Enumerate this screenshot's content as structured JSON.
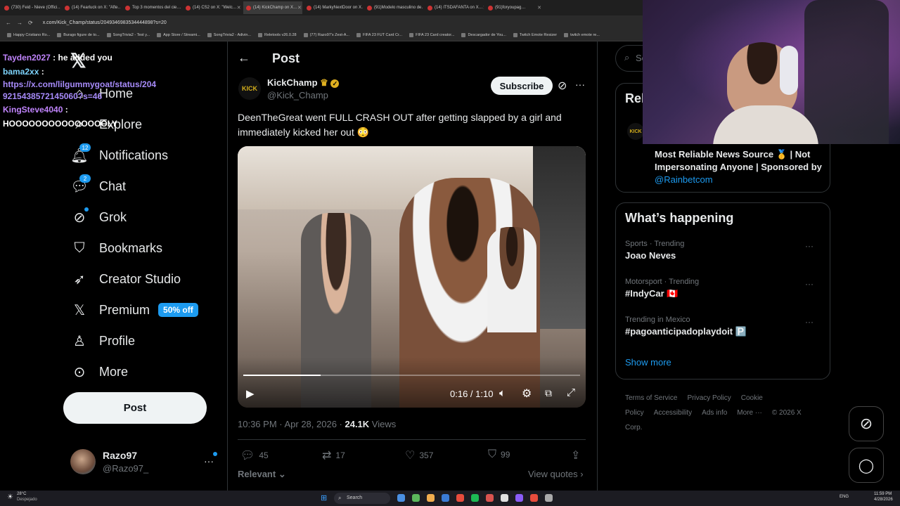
{
  "browser": {
    "tabs": [
      "(730) Feid - Nieve (Offici…",
      "(14) Fearluck on X: \"Afte…",
      "Top 3 momentos del cie…",
      "(14) CS2 on X: \"Welc…",
      "(14) KickChamp on X…",
      "(14) MarkyNextDoor on X…",
      "(91)Modelo masculino de…",
      "(14) ITSDAFANTA on X…",
      "(91)foryoupag…"
    ],
    "url": "x.com/Kick_Champ/status/2049346983534444898?s=20",
    "bookmarks": [
      "Happy Cristiano Ro...",
      "Burago figure de to...",
      "SongTrivia2 - Test y...",
      "App Store / Streami...",
      "SongTrivia2 - Adivin...",
      "Reletools v26.0.28",
      "(77) Razo97's Zest-A...",
      "FIFA 23 FUT Card Cr...",
      "FIFA 23 Card creator...",
      "Descargador de You...",
      "Twitch Emote Resizer",
      "twitch emote re..."
    ]
  },
  "chat_overlay": {
    "lines": [
      {
        "user": "Tayden2027",
        "text": " : he added you"
      },
      {
        "user": "bama2xx",
        "text": " :"
      },
      {
        "user": "",
        "text": "https://x.com/lilgummygoat/status/2049215438572145060?s=46"
      },
      {
        "user": "KingSteve4040",
        "text": " :"
      },
      {
        "user": "",
        "text": "HOOOOOOOOOOOOOOOLY"
      }
    ]
  },
  "sidebar": {
    "items": [
      {
        "label": "Home",
        "icon": "home-icon"
      },
      {
        "label": "Explore",
        "icon": "search-icon"
      },
      {
        "label": "Notifications",
        "icon": "bell-icon",
        "badge": "12"
      },
      {
        "label": "Chat",
        "icon": "chat-icon",
        "badge": "2"
      },
      {
        "label": "Grok",
        "icon": "grok-icon"
      },
      {
        "label": "Bookmarks",
        "icon": "bookmark-icon"
      },
      {
        "label": "Creator Studio",
        "icon": "rocket-icon"
      },
      {
        "label": "Premium",
        "icon": "x-logo-icon",
        "promo": "50% off"
      },
      {
        "label": "Profile",
        "icon": "person-icon"
      },
      {
        "label": "More",
        "icon": "more-circle-icon"
      }
    ],
    "post_button": "Post",
    "account": {
      "name": "Razo97",
      "handle": "@Razo97_"
    }
  },
  "post": {
    "header_title": "Post",
    "author_name": "KickChamp",
    "author_handle": "@Kick_Champ",
    "avatar_text": "KICK",
    "subscribe_label": "Subscribe",
    "text": "DeenTheGreat went FULL CRASH OUT after getting slapped by a girl and immediately kicked her out 😳",
    "video": {
      "time": "0:16 / 1:10",
      "progress": 0.23
    },
    "timestamp": "10:36 PM · Apr 28, 2026 · ",
    "views_count": "24.1K",
    "views_label": " Views",
    "replies": "45",
    "reposts": "17",
    "likes": "357",
    "bookmarks": "99",
    "relevant_label": "Relevant",
    "view_quotes_label": "View quotes"
  },
  "right": {
    "search_placeholder": "Se",
    "relevant_title": "Rele",
    "relevant_bio": "Most Reliable News Source 🥇 | Not Impersonating Anyone | Sponsored by",
    "relevant_link": "@Rainbetcom",
    "happening_title": "What’s happening",
    "trends": [
      {
        "category": "Sports · Trending",
        "name": "Joao Neves"
      },
      {
        "category": "Motorsport · Trending",
        "name": "#IndyCar 🇨🇦"
      },
      {
        "category": "Trending in Mexico",
        "name": "#pagoanticipadoplaydoit 🅿️"
      }
    ],
    "show_more": "Show more",
    "footer": [
      "Terms of Service",
      "Privacy Policy",
      "Cookie Policy",
      "Accessibility",
      "Ads info",
      "More ···",
      "© 2026 X Corp."
    ]
  },
  "taskbar": {
    "weather_temp": "28°C",
    "weather_desc": "Despejado",
    "search_label": "Search",
    "lang": "ENG",
    "time": "11:59 PM",
    "date": "4/28/2026"
  },
  "colors": {
    "accent": "#1d9bf0",
    "bg": "#000000",
    "text": "#e7e9ea",
    "muted": "#71767b",
    "border": "#2f3336"
  }
}
